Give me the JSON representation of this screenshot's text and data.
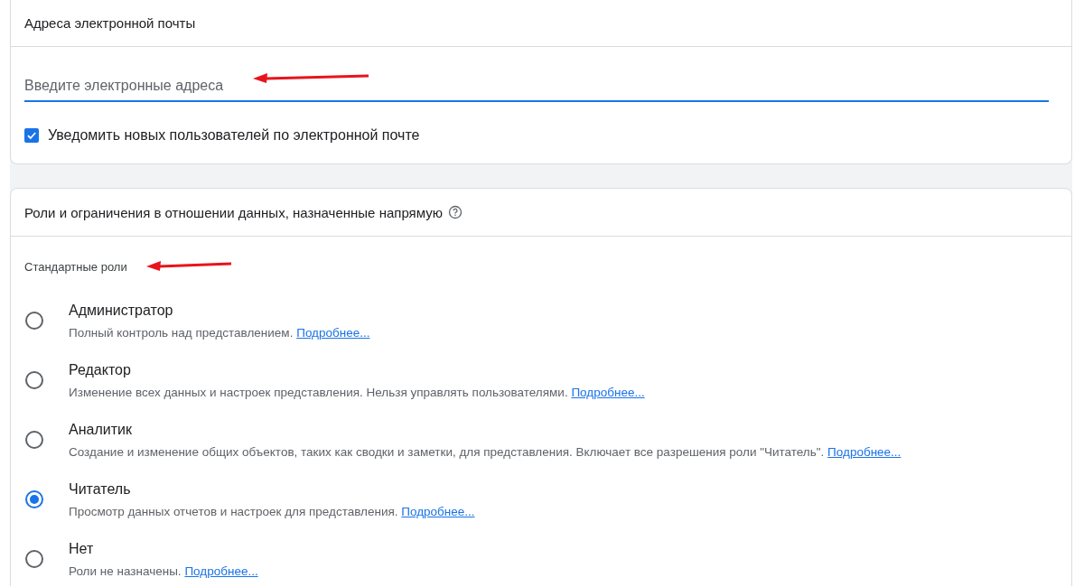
{
  "email_section": {
    "title": "Адреса электронной почты",
    "input": {
      "placeholder": "Введите электронные адреса"
    },
    "notify": {
      "label": "Уведомить новых пользователей по электронной почте",
      "checked": true
    }
  },
  "roles_section": {
    "title": "Роли и ограничения в отношении данных, назначенные напрямую",
    "subtitle": "Стандартные роли",
    "roles": [
      {
        "name": "Администратор",
        "description": "Полный контроль над представлением.",
        "link": "Подробнее...",
        "selected": false
      },
      {
        "name": "Редактор",
        "description": "Изменение всех данных и настроек представления. Нельзя управлять пользователями.",
        "link": "Подробнее...",
        "selected": false
      },
      {
        "name": "Аналитик",
        "description": "Создание и изменение общих объектов, таких как сводки и заметки, для представления. Включает все разрешения роли \"Читатель\".",
        "link": "Подробнее...",
        "selected": false
      },
      {
        "name": "Читатель",
        "description": "Просмотр данных отчетов и настроек для представления.",
        "link": "Подробнее...",
        "selected": true
      },
      {
        "name": "Нет",
        "description": "Роли не назначены.",
        "link": "Подробнее...",
        "selected": false
      }
    ]
  }
}
